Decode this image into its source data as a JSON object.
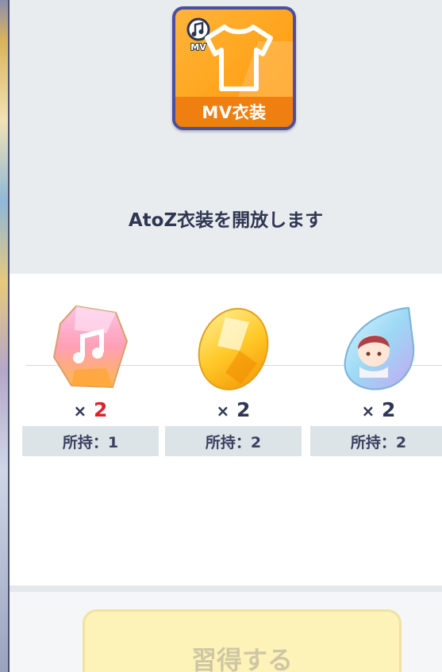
{
  "icon": {
    "name": "mv-costume-icon",
    "badge_text": "MV",
    "label": "MV衣装",
    "accent": "#ffa31a",
    "border": "#4a4f9e"
  },
  "title": "AtoZ衣装を開放します",
  "items": [
    {
      "icon": "music-note-gem-icon",
      "multiplier": "×",
      "count": "2",
      "count_color": "#e0202a",
      "owned": "所持：1"
    },
    {
      "icon": "yellow-gem-icon",
      "multiplier": "×",
      "count": "2",
      "count_color": "#2f3652",
      "owned": "所持：2"
    },
    {
      "icon": "character-drop-gem-icon",
      "multiplier": "×",
      "count": "2",
      "count_color": "#2f3652",
      "owned": "所持：2"
    }
  ],
  "footer": {
    "learn_button": "習得する",
    "learn_button_state": "disabled"
  }
}
